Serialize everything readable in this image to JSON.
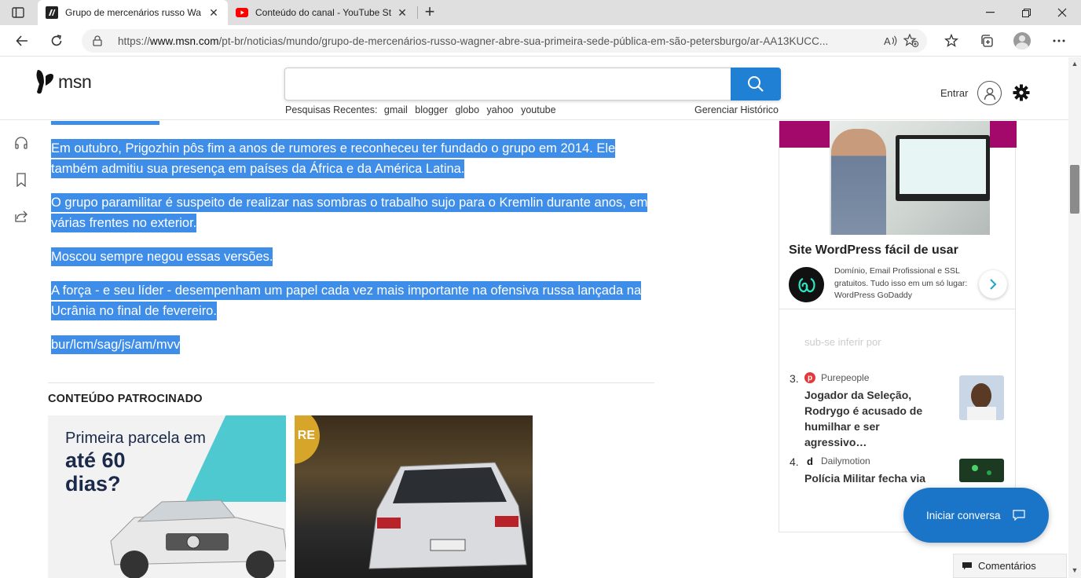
{
  "browser": {
    "tabs": [
      {
        "title": "Grupo de mercenários russo Wa",
        "active": true,
        "favicon": "msn-icon"
      },
      {
        "title": "Conteúdo do canal - YouTube St",
        "active": false,
        "favicon": "youtube-icon"
      }
    ],
    "url_prefix": "https://",
    "url_host": "www.msn.com",
    "url_path": "/pt-br/noticias/mundo/grupo-de-mercenários-russo-wagner-abre-sua-primeira-sede-pública-em-são-petersburgo/ar-AA13KUCC..."
  },
  "header": {
    "logo_text": "msn",
    "search_value": "",
    "recent_label": "Pesquisas Recentes:",
    "recent_items": [
      "gmail",
      "blogger",
      "globo",
      "yahoo",
      "youtube"
    ],
    "history_link": "Gerenciar Histórico",
    "signin_label": "Entrar"
  },
  "article": {
    "paragraphs": [
      "Em outubro, Prigozhin pôs fim a anos de rumores e reconheceu ter fundado o grupo em 2014. Ele também admitiu sua presença em países da África e da América Latina.",
      "O grupo paramilitar é suspeito de realizar nas sombras o trabalho sujo para o Kremlin durante anos, em várias frentes no exterior.",
      "Moscou sempre negou essas versões.",
      "A força - e seu líder - desempenham um papel cada vez mais importante na ofensiva russa lançada na Ucrânia no final de fevereiro.",
      "bur/lcm/sag/js/am/mvv"
    ]
  },
  "sponsored": {
    "title": "CONTEÚDO PATROCINADO",
    "card1_line1": "Primeira parcela em",
    "card1_line2": "até 60",
    "card1_line3": "dias?",
    "card2_badge": "ET RE"
  },
  "ad": {
    "title": "Site WordPress fácil de usar",
    "description": "Domínio, Email Profissional e SSL gratuitos. Tudo isso em um só lugar: WordPress GoDaddy"
  },
  "trending": {
    "ghost_text": "sub-se inferir por",
    "items": [
      {
        "num": "3.",
        "source": "Purepeople",
        "headline": "Jogador da Seleção, Rodrygo é acusado de humilhar e ser agressivo…"
      },
      {
        "num": "4.",
        "source": "Dailymotion",
        "headline": "Polícia Militar fecha via"
      }
    ]
  },
  "chat_label": "Iniciar conversa",
  "comments_label": "Comentários",
  "colors": {
    "selection": "#3e8de8",
    "search_button": "#1f80d4",
    "chat_button": "#1a74c8",
    "ad_band": "#a3096b"
  }
}
